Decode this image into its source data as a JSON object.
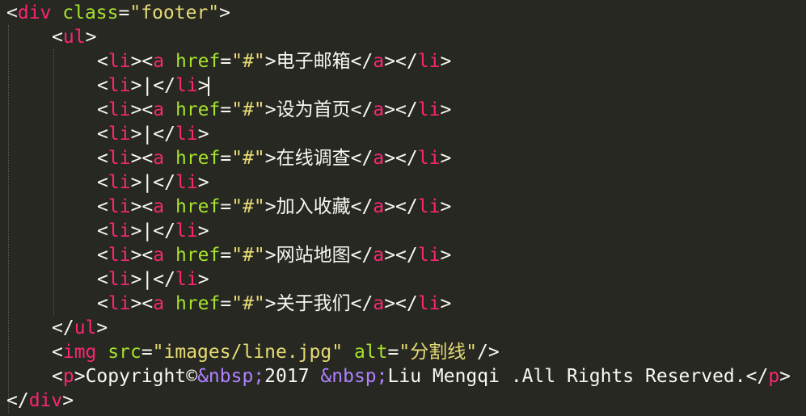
{
  "editor": {
    "theme_colors": {
      "background": "#272822",
      "tag": "#F92672",
      "attribute": "#A6E22E",
      "string": "#E6DB74",
      "entity": "#AE81FF",
      "text": "#F8F8F2"
    },
    "code": {
      "div_tag": "div",
      "class_attr": "class",
      "class_value": "\"footer\"",
      "ul_tag": "ul",
      "li_tag": "li",
      "a_tag": "a",
      "href_attr": "href",
      "href_value": "\"#\"",
      "separator": "|",
      "links": [
        "电子邮箱",
        "设为首页",
        "在线调查",
        "加入收藏",
        "网站地图",
        "关于我们"
      ],
      "img_tag": "img",
      "src_attr": "src",
      "src_value": "\"images/line.jpg\"",
      "alt_attr": "alt",
      "alt_value": "\"分割线\"",
      "p_tag": "p",
      "copyright_text_1": "Copyright©",
      "nbsp_entity": "&nbsp;",
      "copyright_text_2": "2017 ",
      "copyright_text_3": "Liu Mengqi .All Rights Reserved."
    }
  }
}
